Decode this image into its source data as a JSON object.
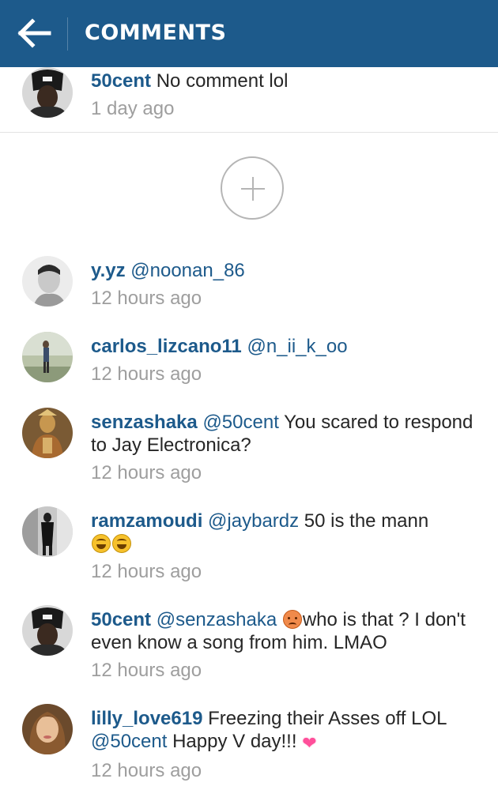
{
  "header": {
    "title": "COMMENTS",
    "back_icon": "arrow-left-icon",
    "bg_color": "#1d5a8b"
  },
  "pinned": {
    "username": "50cent",
    "text": "No comment lol",
    "time": "1 day ago"
  },
  "load_more_icon": "plus-circle-icon",
  "comments": [
    {
      "username": "y.yz",
      "mention": "@noonan_86",
      "text": "",
      "time": "12 hours ago"
    },
    {
      "username": "carlos_lizcano11",
      "mention": "@n_ii_k_oo",
      "text": "",
      "time": "12 hours ago"
    },
    {
      "username": "senzashaka",
      "mention": "@50cent",
      "text": "You scared to respond to Jay Electronica?",
      "time": "12 hours ago"
    },
    {
      "username": "ramzamoudi",
      "mention": "@jaybardz",
      "text": "50 is the mann",
      "time": "12 hours ago"
    },
    {
      "username": "50cent",
      "mention": "@senzashaka",
      "text": "who is that ? I don't even know a song from him. LMAO",
      "time": "12 hours ago"
    },
    {
      "username": "lilly_love619",
      "mention": "@50cent",
      "text_before": "Freezing their Asses off LOL",
      "text": "Happy V day!!!",
      "time": "12 hours ago"
    }
  ],
  "colors": {
    "link": "#1d5a8b",
    "timestamp": "#9e9e9e",
    "text": "#262626"
  }
}
